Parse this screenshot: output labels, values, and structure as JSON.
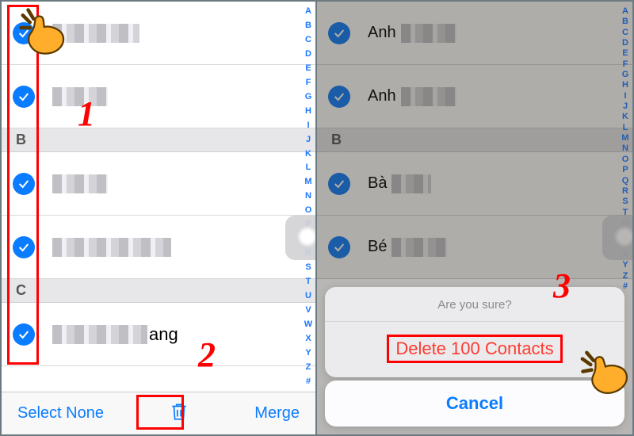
{
  "annotations": {
    "step1": "1",
    "step2": "2",
    "step3": "3"
  },
  "left": {
    "sections": {
      "B": "B",
      "C": "C"
    },
    "contacts": [
      {
        "name": ""
      },
      {
        "name": ""
      },
      {
        "name": ""
      },
      {
        "name": ""
      },
      {
        "name_visible_suffix": "ang"
      }
    ],
    "index_letters": [
      "A",
      "B",
      "C",
      "D",
      "E",
      "F",
      "G",
      "H",
      "I",
      "J",
      "K",
      "L",
      "M",
      "N",
      "O",
      "P",
      "Q",
      "R",
      "S",
      "T",
      "U",
      "V",
      "W",
      "X",
      "Y",
      "Z",
      "#"
    ],
    "toolbar": {
      "select_none": "Select None",
      "trash_icon": "trash-icon",
      "merge": "Merge"
    }
  },
  "right": {
    "sections": {
      "B": "B"
    },
    "contacts": [
      {
        "name_prefix": "Anh"
      },
      {
        "name_prefix": "Anh"
      },
      {
        "name_prefix": "Bà"
      },
      {
        "name_prefix": "Bé"
      }
    ],
    "index_letters": [
      "A",
      "B",
      "C",
      "D",
      "E",
      "F",
      "G",
      "H",
      "I",
      "J",
      "K",
      "L",
      "M",
      "N",
      "O",
      "P",
      "Q",
      "R",
      "S",
      "T",
      "U",
      "V",
      "W",
      "X",
      "Y",
      "Z",
      "#"
    ],
    "action_sheet": {
      "title": "Are you sure?",
      "destructive": "Delete 100 Contacts",
      "cancel": "Cancel"
    }
  }
}
